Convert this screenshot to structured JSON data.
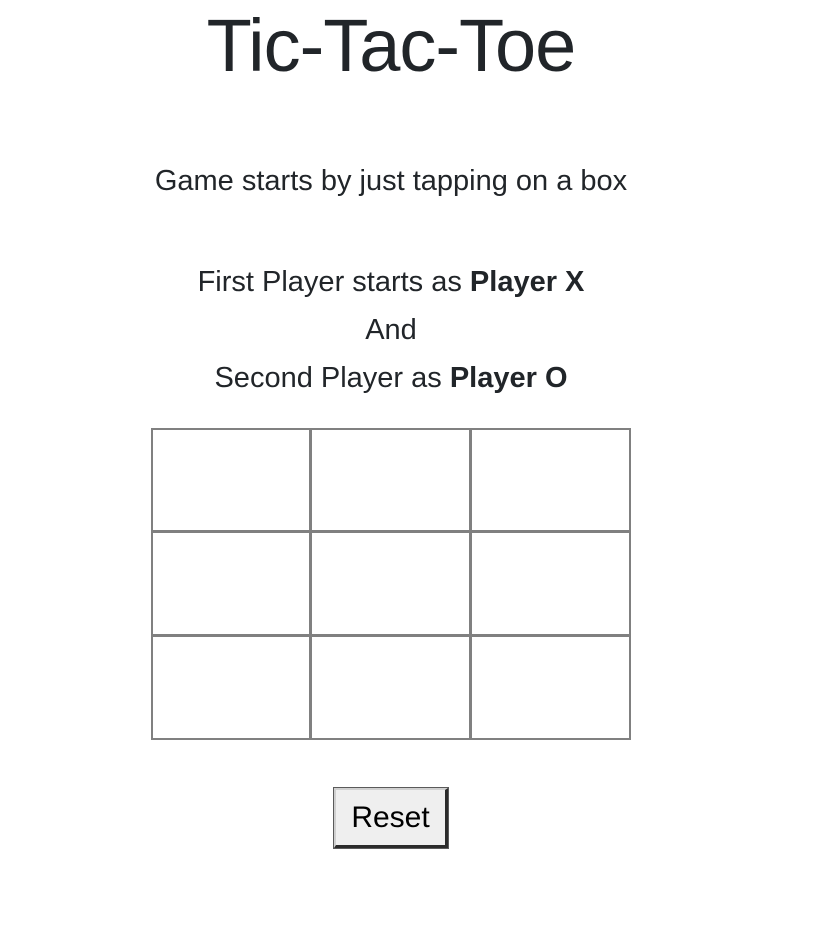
{
  "header": {
    "title": "Tic-Tac-Toe"
  },
  "instructions": {
    "intro": "Game starts by just tapping on a box",
    "line1_prefix": "First Player starts as ",
    "line1_bold": "Player X",
    "line2": "And",
    "line3_prefix": "Second Player as ",
    "line3_bold": "Player O"
  },
  "board": {
    "cells": [
      "",
      "",
      "",
      "",
      "",
      "",
      "",
      "",
      ""
    ]
  },
  "controls": {
    "reset_label": "Reset"
  },
  "colors": {
    "text": "#212529",
    "grid_border": "#808080",
    "button_bg": "#efefef"
  }
}
